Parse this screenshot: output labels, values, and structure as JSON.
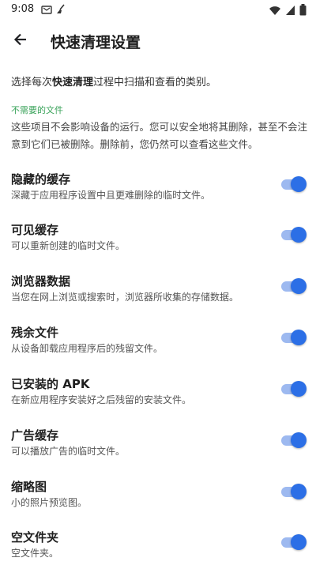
{
  "status": {
    "time": "9:08"
  },
  "appbar": {
    "title": "快速清理设置"
  },
  "intro": {
    "pre": "选择每次",
    "bold": "快速清理",
    "post": "过程中扫描和查看的类别。"
  },
  "section": {
    "header": "不需要的文件",
    "desc": "这些项目不会影响设备的运行。您可以安全地将其删除，甚至不会注意到它们已被删除。删除前，您仍然可以查看这些文件。"
  },
  "items": [
    {
      "title": "隐藏的缓存",
      "sub": "深藏于应用程序设置中且更难删除的临时文件。",
      "on": true
    },
    {
      "title": "可见缓存",
      "sub": "可以重新创建的临时文件。",
      "on": true
    },
    {
      "title": "浏览器数据",
      "sub": "当您在网上浏览或搜索时，浏览器所收集的存储数据。",
      "on": true
    },
    {
      "title": "残余文件",
      "sub": "从设备卸载应用程序后的残留文件。",
      "on": true
    },
    {
      "title": "已安装的 APK",
      "sub": "在新应用程序安装好之后残留的安装文件。",
      "on": true
    },
    {
      "title": "广告缓存",
      "sub": "可以播放广告的临时文件。",
      "on": true
    },
    {
      "title": "缩略图",
      "sub": "小的照片预览图。",
      "on": true
    },
    {
      "title": "空文件夹",
      "sub": "空文件夹。",
      "on": true
    }
  ],
  "colors": {
    "accent": "#2c6fe6",
    "track": "#9db9f0",
    "section": "#3aa35a"
  }
}
